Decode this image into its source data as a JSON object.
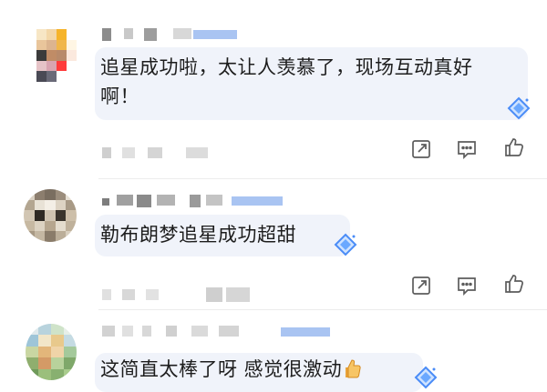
{
  "comments": [
    {
      "text": "追星成功啦，太让人羡慕了，现场互动真好",
      "text_line2": "啊！",
      "avatar_icon": "pixelated-avatar",
      "badge_icon": "diamond-badge-icon"
    },
    {
      "text": "勒布朗梦追星成功超甜",
      "avatar_icon": "pixelated-avatar",
      "badge_icon": "diamond-badge-icon"
    },
    {
      "text": "这简直太棒了呀 感觉很激动",
      "emoji": "thumbs-up-emoji",
      "avatar_icon": "pixelated-avatar",
      "badge_icon": "diamond-badge-icon"
    }
  ],
  "actions": {
    "share_icon": "share-icon",
    "comment_icon": "comment-icon",
    "like_icon": "like-icon"
  },
  "colors": {
    "bubble": "#f0f3fa",
    "icon_stroke": "#5c5c5c",
    "badge_blue": "#4a8cf7",
    "divider": "#ececec"
  }
}
